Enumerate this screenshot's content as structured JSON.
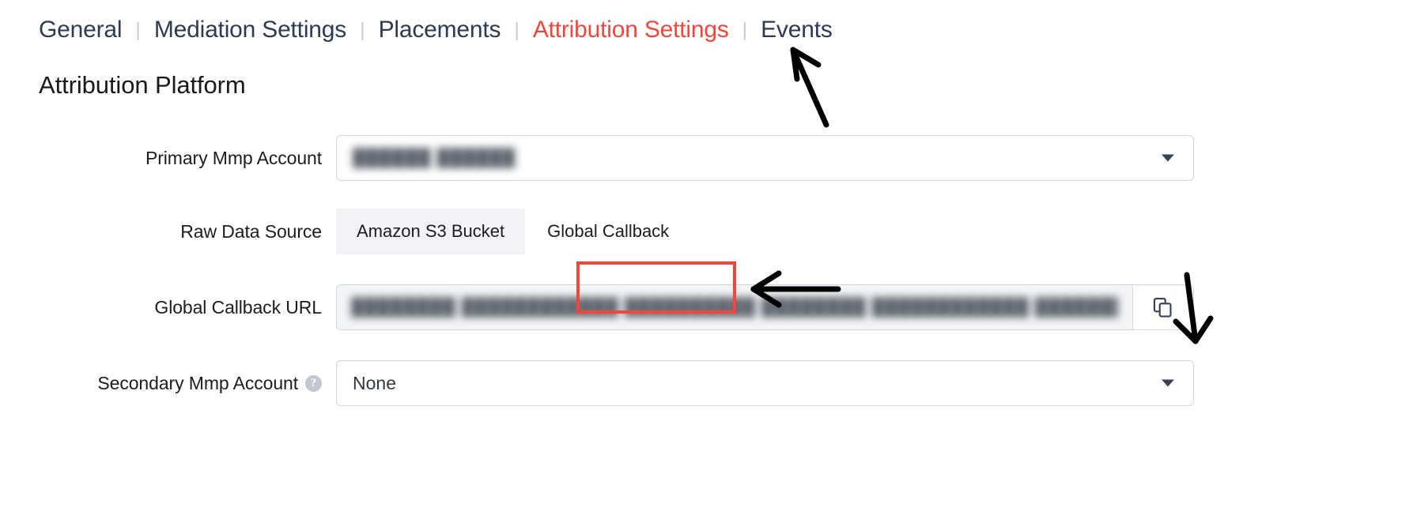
{
  "tabs": [
    {
      "label": "General",
      "active": false
    },
    {
      "label": "Mediation Settings",
      "active": false
    },
    {
      "label": "Placements",
      "active": false
    },
    {
      "label": "Attribution Settings",
      "active": true
    },
    {
      "label": "Events",
      "active": false
    }
  ],
  "tab_separator": "|",
  "page_title": "Attribution Platform",
  "form": {
    "primary_mmp": {
      "label": "Primary Mmp Account",
      "value": "██████  ██████",
      "redacted": true
    },
    "raw_data_source": {
      "label": "Raw Data Source",
      "options": [
        "Amazon S3 Bucket",
        "Global Callback"
      ],
      "selected": "Global Callback"
    },
    "global_callback_url": {
      "label": "Global Callback URL",
      "value": "████████ ████████████ ██████████ ████████ ████████████ ██████████ ████████",
      "redacted": true,
      "disabled": true,
      "copy_button_icon": "copy-icon"
    },
    "secondary_mmp": {
      "label": "Secondary Mmp Account",
      "help_icon": "question-mark-icon",
      "help_glyph": "?",
      "value": "None"
    }
  },
  "colors": {
    "active_tab": "#f0463c",
    "tab_text": "#2e3a52",
    "annotation": "#000000",
    "highlight_box": "#f0463c",
    "segment_selected_bg": "#f2f3f8",
    "field_border": "#cfd4de"
  },
  "annotations": {
    "arrow_to_attribution_tab": "arrow-up-icon",
    "arrow_to_global_callback": "arrow-left-icon",
    "arrow_to_copy_button": "arrow-down-icon",
    "highlight_global_callback": "red-rectangle-highlight"
  }
}
